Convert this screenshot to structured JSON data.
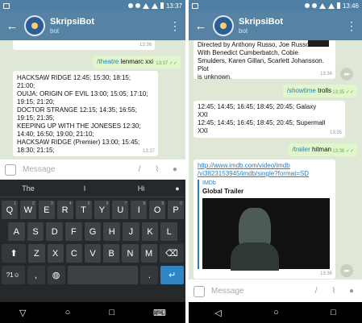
{
  "screen1": {
    "status_time": "13:37",
    "chat_title": "SkripsiBot",
    "chat_subtitle": "bot",
    "top_time": "13:36",
    "cmd_msg": {
      "command": "/theatre",
      "arg": "lenmarc xxi",
      "time": "13:37"
    },
    "schedule_lines": [
      "HACKSAW RIDGE 12:45; 15:30; 18:15;",
      "21:00;",
      "OUIJA: ORIGIN OF EVIL 13:00; 15:05; 17:10;",
      "19:15; 21:20;",
      "DOCTOR STRANGE 12:15; 14:35; 16:55;",
      "19:15; 21:35;",
      "KEEPING UP WITH THE JONESES 12:30;",
      "14:40; 16:50; 19:00; 21:10;",
      "HACKSAW RIDGE (Premier) 13:00; 15:45;",
      "18:30; 21:15;"
    ],
    "schedule_time": "13:37",
    "input_placeholder": "Message",
    "suggestions": [
      "The",
      "I",
      "Hi"
    ],
    "keys_row1": [
      {
        "k": "Q",
        "n": "1"
      },
      {
        "k": "W",
        "n": "2"
      },
      {
        "k": "E",
        "n": "3"
      },
      {
        "k": "R",
        "n": "4"
      },
      {
        "k": "T",
        "n": "5"
      },
      {
        "k": "Y",
        "n": "6"
      },
      {
        "k": "U",
        "n": "7"
      },
      {
        "k": "I",
        "n": "8"
      },
      {
        "k": "O",
        "n": "9"
      },
      {
        "k": "P",
        "n": "0"
      }
    ],
    "keys_row2": [
      "A",
      "S",
      "D",
      "F",
      "G",
      "H",
      "J",
      "K",
      "L"
    ],
    "keys_row3": [
      "Z",
      "X",
      "C",
      "V",
      "B",
      "N",
      "M"
    ],
    "key_symbols": "?1☺",
    "key_comma": ",",
    "key_period": ".",
    "key_enter": "↵"
  },
  "screen2": {
    "status_time": "13:46",
    "chat_title": "SkripsiBot",
    "chat_subtitle": "bot",
    "movie_lines": [
      "Directed by Anthony Russo, Joe Russo.",
      "With Benedict Cumberbatch, Cobie",
      "Smulders, Karen Gillan, Scarlett Johansson. Plot",
      "is unknown."
    ],
    "movie_time": "13:34",
    "cmd_showtime": {
      "command": "/showtime",
      "arg": "trolls",
      "time": "13:35"
    },
    "showtime_lines": [
      "12:45; 14:45; 16:45; 18:45; 20:45; Galaxy",
      "XXI",
      "12:45; 14:45; 16:45; 18:45; 20:45; Supermall",
      "XXI"
    ],
    "showtime_time": "13:35",
    "cmd_trailer": {
      "command": "/trailer",
      "arg": "hitman",
      "time": "13:36"
    },
    "link_lines": [
      "http://www.imdb.com/video/imdb",
      "/vi3823153945/imdb/single?format=SD"
    ],
    "preview_site": "IMDb",
    "preview_title": "Global Trailer",
    "link_time": "13:36",
    "input_placeholder": "Message"
  },
  "colors": {
    "header": "#5682a3",
    "statusbar": "#4e7fa5",
    "chat_bg": "#dfe7d7",
    "out_bubble": "#e1f7cb",
    "link": "#2c7fb8"
  }
}
